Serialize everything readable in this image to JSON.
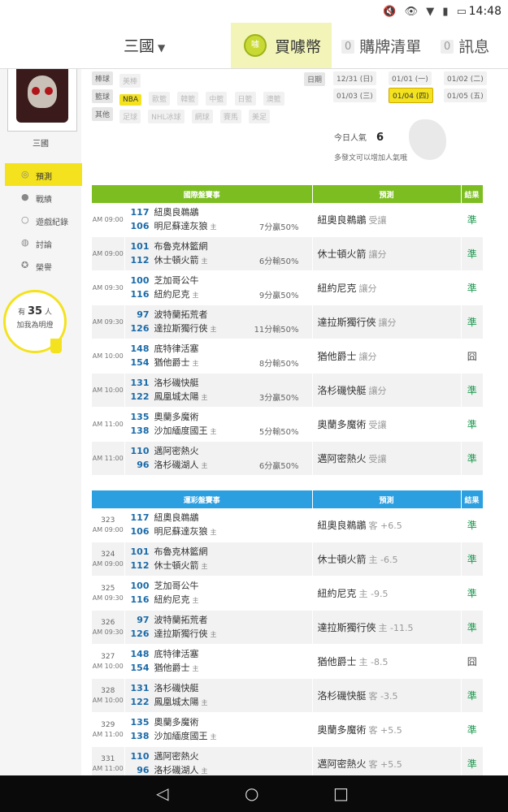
{
  "status_bar": {
    "icons": "🔇 👁 ▼ ▮ ▭",
    "time": "14:48"
  },
  "nav": {
    "user_label": "三國",
    "coin_icon": "coin-icon",
    "coins_label": "買噱幣",
    "cart": {
      "count": "0",
      "label": "購牌清單"
    },
    "messages": {
      "count": "0",
      "label": "訊息"
    }
  },
  "sidebar": {
    "user_name": "三國",
    "menu": [
      {
        "label": "預測",
        "icon": "target-icon",
        "active": true
      },
      {
        "label": "戰績",
        "icon": "chat-icon"
      },
      {
        "label": "遊戲紀錄",
        "icon": "circle-icon"
      },
      {
        "label": "討論",
        "icon": "discussion-icon"
      },
      {
        "label": "榮譽",
        "icon": "medal-icon"
      }
    ],
    "fans": {
      "prefix": "有",
      "count": "35",
      "suffix": "人",
      "line2": "加我為明燈"
    }
  },
  "filters": {
    "rows": [
      {
        "category": "棒球",
        "tags": [
          "美棒"
        ]
      },
      {
        "category": "籃球",
        "tags": [
          "NBA",
          "歐籃",
          "韓籃",
          "中籃",
          "日籃",
          "澳籃"
        ]
      },
      {
        "category": "其他",
        "tags": [
          "足球",
          "NHL冰球",
          "網球",
          "賽馬",
          "美足"
        ]
      }
    ],
    "selected_tag": "NBA"
  },
  "dates": {
    "label": "日期",
    "items": [
      "12/31 (日)",
      "01/01 (一)",
      "01/02 (二)",
      "01/03 (三)",
      "01/04 (四)",
      "01/05 (五)"
    ],
    "selected": "01/04 (四)"
  },
  "popularity": {
    "label": "今日人氣",
    "value": "6",
    "hint": "多發文可以增加人氣哦"
  },
  "intl_table": {
    "headers": [
      "國際盤賽事",
      "預測",
      "結果"
    ],
    "rows": [
      {
        "time": "AM 09:00",
        "away_score": "117",
        "away": "紐奧良鵜鶘",
        "home_score": "106",
        "home": "明尼蘇達灰狼",
        "note": "7分贏50%",
        "pick": "紐奧良鵜鶘",
        "pick_type": "受讓",
        "result": "準"
      },
      {
        "time": "AM 09:00",
        "away_score": "101",
        "away": "布魯克林籃網",
        "home_score": "112",
        "home": "休士頓火箭",
        "note": "6分輸50%",
        "pick": "休士頓火箭",
        "pick_type": "讓分",
        "result": "準"
      },
      {
        "time": "AM 09:30",
        "away_score": "100",
        "away": "芝加哥公牛",
        "home_score": "116",
        "home": "紐約尼克",
        "note": "9分贏50%",
        "pick": "紐約尼克",
        "pick_type": "讓分",
        "result": "準"
      },
      {
        "time": "AM 09:30",
        "away_score": "97",
        "away": "波特蘭拓荒者",
        "home_score": "126",
        "home": "達拉斯獨行俠",
        "note": "11分輸50%",
        "pick": "達拉斯獨行俠",
        "pick_type": "讓分",
        "result": "準"
      },
      {
        "time": "AM 10:00",
        "away_score": "148",
        "away": "底特律活塞",
        "home_score": "154",
        "home": "猶他爵士",
        "note": "8分輸50%",
        "pick": "猶他爵士",
        "pick_type": "讓分",
        "result": "囧"
      },
      {
        "time": "AM 10:00",
        "away_score": "131",
        "away": "洛杉磯快艇",
        "home_score": "122",
        "home": "鳳凰城太陽",
        "note": "3分贏50%",
        "pick": "洛杉磯快艇",
        "pick_type": "讓分",
        "result": "準"
      },
      {
        "time": "AM 11:00",
        "away_score": "135",
        "away": "奧蘭多魔術",
        "home_score": "138",
        "home": "沙加緬度國王",
        "note": "5分輸50%",
        "pick": "奧蘭多魔術",
        "pick_type": "受讓",
        "result": "準"
      },
      {
        "time": "AM 11:00",
        "away_score": "110",
        "away": "邁阿密熱火",
        "home_score": "96",
        "home": "洛杉磯湖人",
        "note": "6分贏50%",
        "pick": "邁阿密熱火",
        "pick_type": "受讓",
        "result": "準"
      }
    ]
  },
  "lottery_table": {
    "headers": [
      "運彩盤賽事",
      "預測",
      "結果"
    ],
    "rows": [
      {
        "no": "323",
        "time": "AM 09:00",
        "away_score": "117",
        "away": "紐奧良鵜鶘",
        "home_score": "106",
        "home": "明尼蘇達灰狼",
        "pick": "紐奧良鵜鶘",
        "pick_type": "客 +6.5",
        "result": "準"
      },
      {
        "no": "324",
        "time": "AM 09:00",
        "away_score": "101",
        "away": "布魯克林籃網",
        "home_score": "112",
        "home": "休士頓火箭",
        "pick": "休士頓火箭",
        "pick_type": "主 -6.5",
        "result": "準"
      },
      {
        "no": "325",
        "time": "AM 09:30",
        "away_score": "100",
        "away": "芝加哥公牛",
        "home_score": "116",
        "home": "紐約尼克",
        "pick": "紐約尼克",
        "pick_type": "主 -9.5",
        "result": "準"
      },
      {
        "no": "326",
        "time": "AM 09:30",
        "away_score": "97",
        "away": "波特蘭拓荒者",
        "home_score": "126",
        "home": "達拉斯獨行俠",
        "pick": "達拉斯獨行俠",
        "pick_type": "主 -11.5",
        "result": "準"
      },
      {
        "no": "327",
        "time": "AM 10:00",
        "away_score": "148",
        "away": "底特律活塞",
        "home_score": "154",
        "home": "猶他爵士",
        "pick": "猶他爵士",
        "pick_type": "主 -8.5",
        "result": "囧"
      },
      {
        "no": "328",
        "time": "AM 10:00",
        "away_score": "131",
        "away": "洛杉磯快艇",
        "home_score": "122",
        "home": "鳳凰城太陽",
        "pick": "洛杉磯快艇",
        "pick_type": "客 -3.5",
        "result": "準"
      },
      {
        "no": "329",
        "time": "AM 11:00",
        "away_score": "135",
        "away": "奧蘭多魔術",
        "home_score": "138",
        "home": "沙加緬度國王",
        "pick": "奧蘭多魔術",
        "pick_type": "客 +5.5",
        "result": "準"
      },
      {
        "no": "331",
        "time": "AM 11:00",
        "away_score": "110",
        "away": "邁阿密熱火",
        "home_score": "96",
        "home": "洛杉磯湖人",
        "pick": "邁阿密熱火",
        "pick_type": "客 +5.5",
        "result": "準"
      }
    ]
  },
  "home_marker": "主",
  "colors": {
    "accent_yellow": "#f3e21d",
    "intl_header": "#7cbd22",
    "lottery_header": "#2b9fe0",
    "win": "#1d9a50"
  }
}
